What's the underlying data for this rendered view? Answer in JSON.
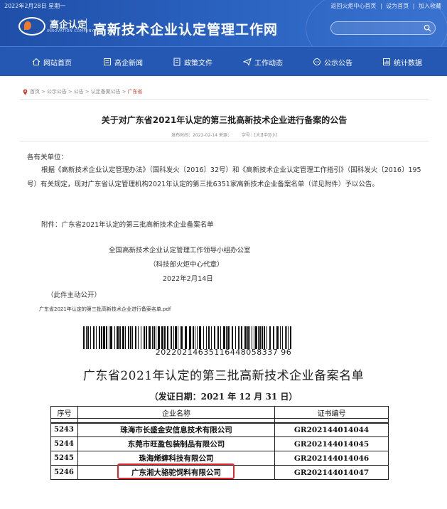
{
  "header": {
    "date": "2022年2月28日 星期一",
    "top_links": [
      "返回火炬中心首页",
      "|",
      "设为首页",
      "|",
      "加入收藏"
    ],
    "logo_text": "高企认定",
    "logo_sub": "INNOVATION COMPANY",
    "site_title": "高新技术企业认定管理工作网",
    "search_placeholder": ""
  },
  "nav": [
    {
      "label": "网站首页",
      "icon": "home-icon"
    },
    {
      "label": "高企新闻",
      "icon": "news-icon"
    },
    {
      "label": "政策文件",
      "icon": "document-icon"
    },
    {
      "label": "工作动态",
      "icon": "paper-plane-icon"
    },
    {
      "label": "公示公告",
      "icon": "chat-icon"
    },
    {
      "label": "统计数据",
      "icon": "chart-icon"
    }
  ],
  "breadcrumb": [
    "首页",
    "公示公告",
    "公告",
    "认定备案公告",
    "广东省"
  ],
  "article": {
    "title": "关于对广东省2021年认定的第三批高新技术企业进行备案的公告",
    "meta_published": "发布时间：2022-02-14 来源：",
    "meta_fontsize": "字号：",
    "font_sizes": [
      "[大]",
      "[中]",
      "[小]"
    ],
    "greeting": "各有关单位：",
    "body": "根据《高新技术企业认定管理办法》（国科发火〔2016〕32号）和《高新技术企业认定管理工作指引》（国科发火〔2016〕195号）有关规定，现对广东省认定管理机构2021年认定的第三批6351家高新技术企业备案名单（详见附件）予以公告。",
    "attachment": "附件：广东省2021年认定的第三批高新技术企业备案名单",
    "signature_org": "全国高新技术企业认定管理工作领导小组办公室",
    "signature_seal": "（科技部火炬中心代章）",
    "signature_date": "2022年2月14日",
    "public_note": "（此件主动公开）",
    "pdf_link": "广东省2021年认定的第三批高新技术企业进行备案名单.pdf"
  },
  "document": {
    "barcode_number": "20220214635116448058337 96",
    "title": "广东省2021年认定的第三批高新技术企业备案名单",
    "issue_date": "（发证日期：2021 年 12 月 31 日）",
    "columns": [
      "序号",
      "企业名称",
      "证书编号"
    ],
    "rows": [
      {
        "no": "5243",
        "name": "珠海市长盛金安信息技术有限公司",
        "cert": "GR202144014044"
      },
      {
        "no": "5244",
        "name": "东莞市旺盈包装制品有限公司",
        "cert": "GR202144014045"
      },
      {
        "no": "5245",
        "name": "珠海烯蟀科技有限公司",
        "cert": "GR202144014046"
      },
      {
        "no": "5246",
        "name": "广东湘大骆驼饲料有限公司",
        "cert": "GR202144014047"
      }
    ],
    "highlight_color": "#e0242a"
  },
  "colors": {
    "header_bg": "#1f4fa8",
    "nav_bg": "#2458b3",
    "breadcrumb_current": "#c43a2a"
  }
}
